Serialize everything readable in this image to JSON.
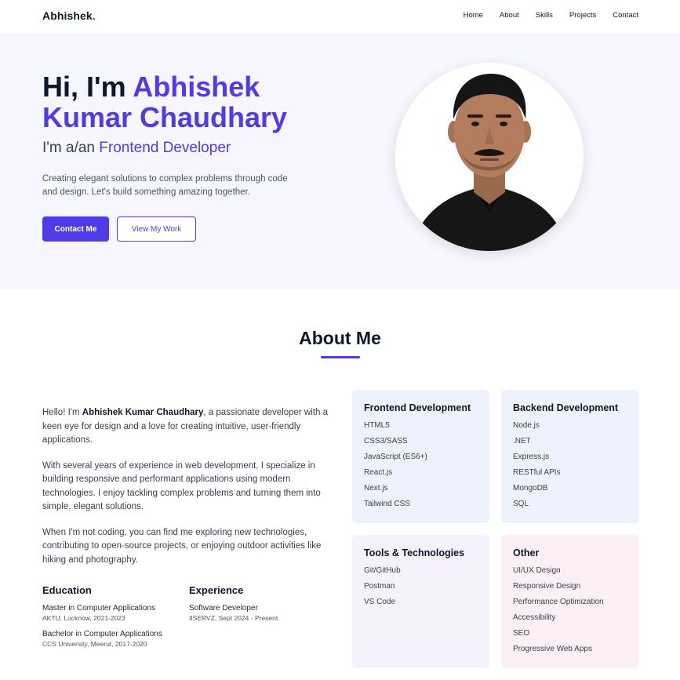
{
  "nav": {
    "logo": "Abhishek",
    "logo_dot": ".",
    "links": [
      "Home",
      "About",
      "Skills",
      "Projects",
      "Contact"
    ]
  },
  "hero": {
    "greeting": "Hi, I'm ",
    "name": "Abhishek Kumar Chaudhary",
    "role_prefix": "I'm a/an ",
    "role": "Frontend Developer",
    "description": "Creating elegant solutions to complex problems through code and design. Let's build something amazing together.",
    "primary_button": "Contact Me",
    "secondary_button": "View My Work"
  },
  "about": {
    "title": "About Me",
    "intro_prefix": "Hello! I'm ",
    "intro_name": "Abhishek Kumar Chaudhary",
    "intro_suffix": ", a passionate developer with a keen eye for design and a love for creating intuitive, user-friendly applications.",
    "paragraph2": "With several years of experience in web development, I specialize in building responsive and performant applications using modern technologies. I enjoy tackling complex problems and turning them into simple, elegant solutions.",
    "paragraph3": "When I'm not coding, you can find me exploring new technologies, contributing to open-source projects, or enjoying outdoor activities like hiking and photography.",
    "education": {
      "heading": "Education",
      "entries": [
        {
          "title": "Master in Computer Applications",
          "sub": "AKTU, Lucknow, 2021-2023"
        },
        {
          "title": "Bachelor in Computer Applications",
          "sub": "CCS University, Meerut, 2017-2020"
        }
      ]
    },
    "experience": {
      "heading": "Experience",
      "entries": [
        {
          "title": "Software Developer",
          "sub": "IISERVZ, Sept 2024 - Present"
        }
      ]
    }
  },
  "skills": {
    "frontend": {
      "title": "Frontend Development",
      "items": [
        "HTML5",
        "CSS3/SASS",
        "JavaScript (ES6+)",
        "React.js",
        "Next.js",
        "Tailwind CSS"
      ]
    },
    "backend": {
      "title": "Backend Development",
      "items": [
        "Node.js",
        ".NET",
        "Express.js",
        "RESTful APIs",
        "MongoDB",
        "SQL"
      ]
    },
    "tools": {
      "title": "Tools & Technologies",
      "items": [
        "Git/GitHub",
        "Postman",
        "VS Code"
      ]
    },
    "other": {
      "title": "Other",
      "items": [
        "UI/UX Design",
        "Responsive Design",
        "Performance Optimization",
        "Accessibility",
        "SEO",
        "Progressive Web Apps"
      ]
    }
  },
  "colors": {
    "accent": "#4f3ce8",
    "hero_bg": "#f5f6fe"
  }
}
